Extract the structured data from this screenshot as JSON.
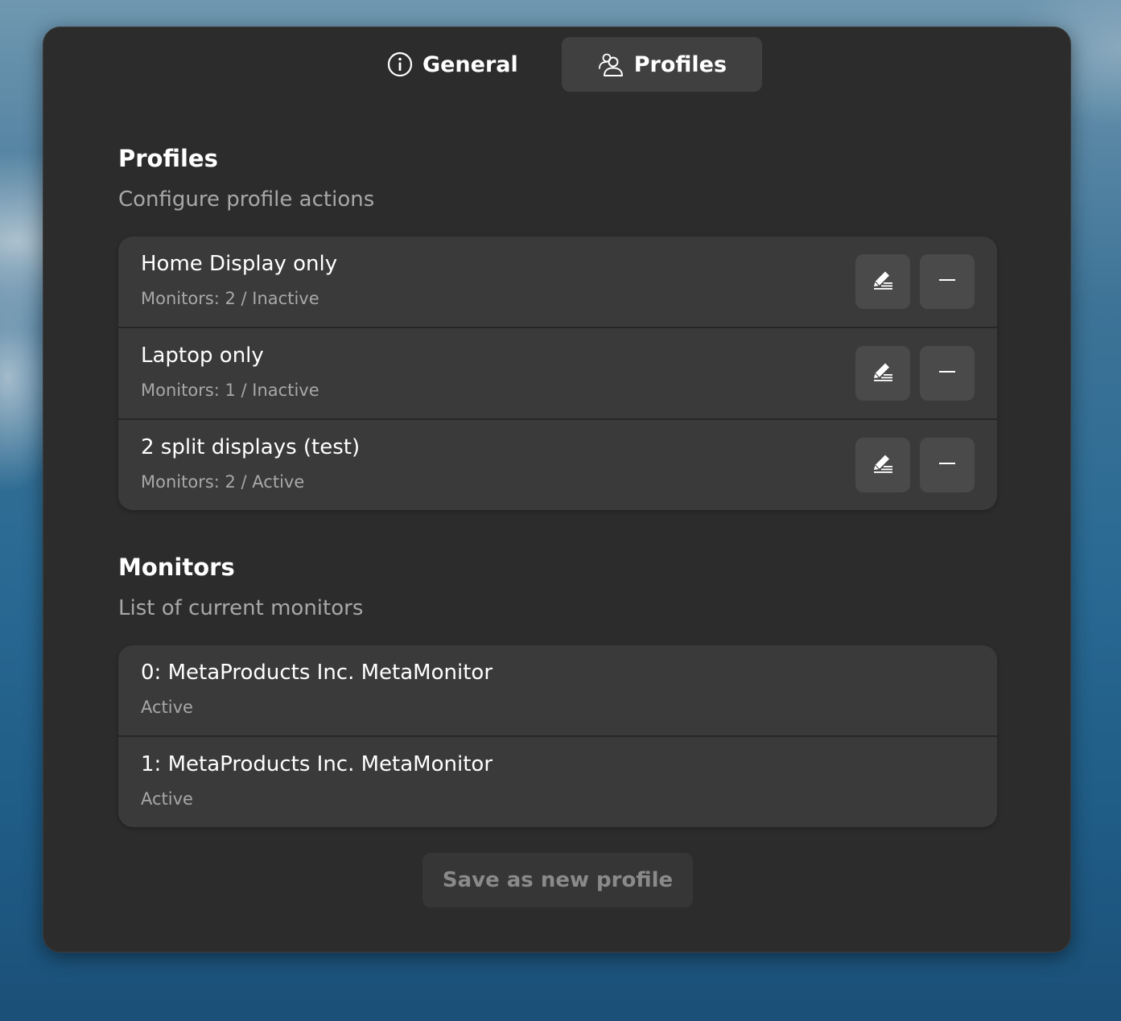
{
  "tabs": [
    {
      "label": "General",
      "icon": "info-icon",
      "active": false
    },
    {
      "label": "Profiles",
      "icon": "profiles-icon",
      "active": true
    }
  ],
  "profiles_section": {
    "title": "Profiles",
    "subtitle": "Configure profile actions",
    "items": [
      {
        "name": "Home Display only",
        "detail": "Monitors: 2 / Inactive"
      },
      {
        "name": "Laptop only",
        "detail": "Monitors: 1 / Inactive"
      },
      {
        "name": "2 split displays (test)",
        "detail": "Monitors: 2 / Active"
      }
    ]
  },
  "monitors_section": {
    "title": "Monitors",
    "subtitle": "List of current monitors",
    "items": [
      {
        "name": "0: MetaProducts Inc. MetaMonitor",
        "status": "Active"
      },
      {
        "name": "1: MetaProducts Inc. MetaMonitor",
        "status": "Active"
      }
    ]
  },
  "save_button_label": "Save as new profile",
  "colors": {
    "window_bg": "#2c2c2c",
    "row_bg": "#3a3a3a",
    "button_bg": "#4a4a4a",
    "active_tab_bg": "#404040",
    "secondary_text": "#a8a8a8"
  }
}
